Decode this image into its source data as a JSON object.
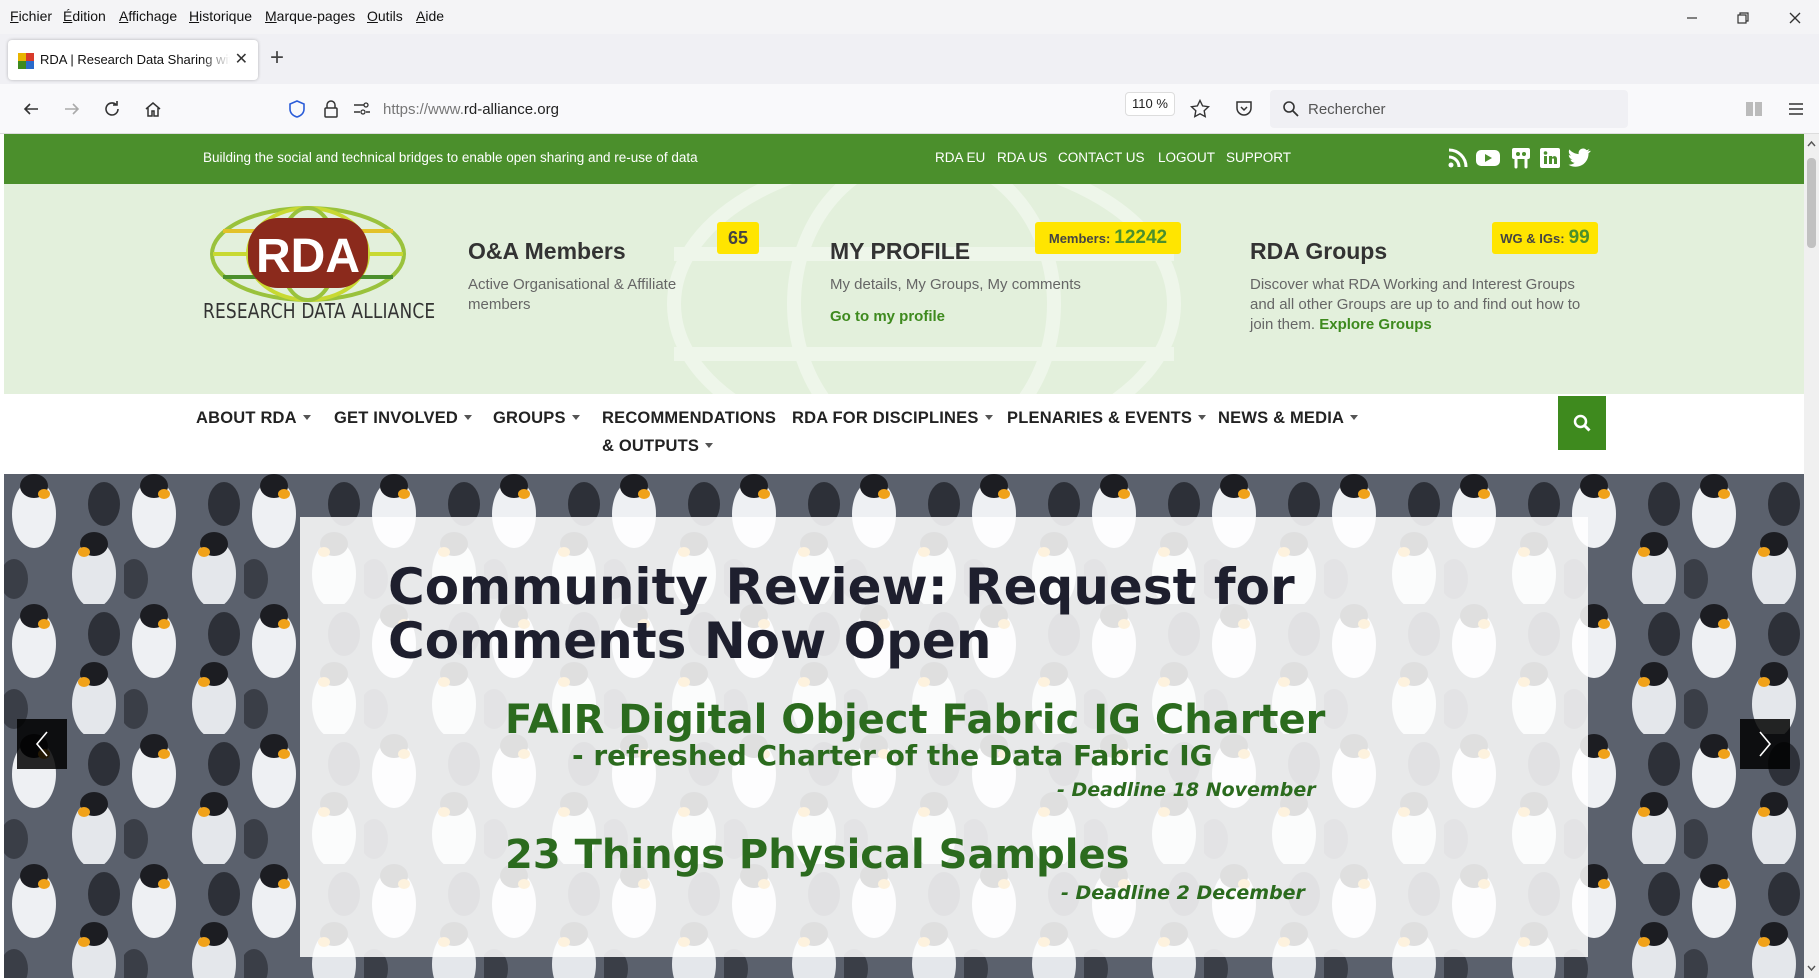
{
  "browser": {
    "menu": [
      "Fichier",
      "Édition",
      "Affichage",
      "Historique",
      "Marque-pages",
      "Outils",
      "Aide"
    ],
    "tab_title": "RDA | Research Data Sharing without",
    "url_prefix": "https://www.",
    "url_domain": "rd-alliance.org",
    "zoom": "110 %",
    "search_placeholder": "Rechercher"
  },
  "topbar": {
    "tagline": "Building the social and technical bridges to enable open sharing and re-use of data",
    "links": [
      "RDA EU",
      "RDA US",
      "CONTACT US",
      "LOGOUT",
      "SUPPORT"
    ],
    "social": [
      "rss-icon",
      "youtube-icon",
      "slideshare-icon",
      "linkedin-icon",
      "twitter-icon"
    ]
  },
  "header": {
    "logo_text": "RDA",
    "logo_subtitle": "RESEARCH DATA ALLIANCE",
    "members": {
      "title": "O&A Members",
      "count": "65",
      "desc": "Active Organisational & Affiliate members"
    },
    "profile": {
      "title": "MY PROFILE",
      "badge_label": "Members:",
      "badge_value": "12242",
      "desc": "My details, My Groups, My comments",
      "link": "Go to my profile"
    },
    "groups": {
      "title": "RDA Groups",
      "badge_label": "WG & IGs:",
      "badge_value": "99",
      "desc": "Discover what RDA Working and Interest Groups and all other Groups are up to and find out how to join them.",
      "link": "Explore Groups"
    }
  },
  "nav": {
    "items": [
      "ABOUT RDA",
      "GET INVOLVED",
      "GROUPS",
      "RECOMMENDATIONS",
      "RDA FOR DISCIPLINES",
      "PLENARIES & EVENTS",
      "NEWS & MEDIA"
    ],
    "item3_line2": "& OUTPUTS"
  },
  "hero": {
    "title": "Community Review: Request for Comments Now Open",
    "item1_title": "FAIR Digital Object Fabric IG Charter",
    "item1_sub": "- refreshed Charter of the Data Fabric IG",
    "item1_deadline": "- Deadline 18 November",
    "item2_title": "23 Things Physical Samples",
    "item2_deadline": "- Deadline 2 December"
  },
  "colors": {
    "brand_green": "#4b8f2c",
    "header_bg": "#e3f0dc",
    "badge_yellow": "#ffe500",
    "hero_title": "#1e1f2e",
    "hero_green": "#2b6b1e"
  }
}
